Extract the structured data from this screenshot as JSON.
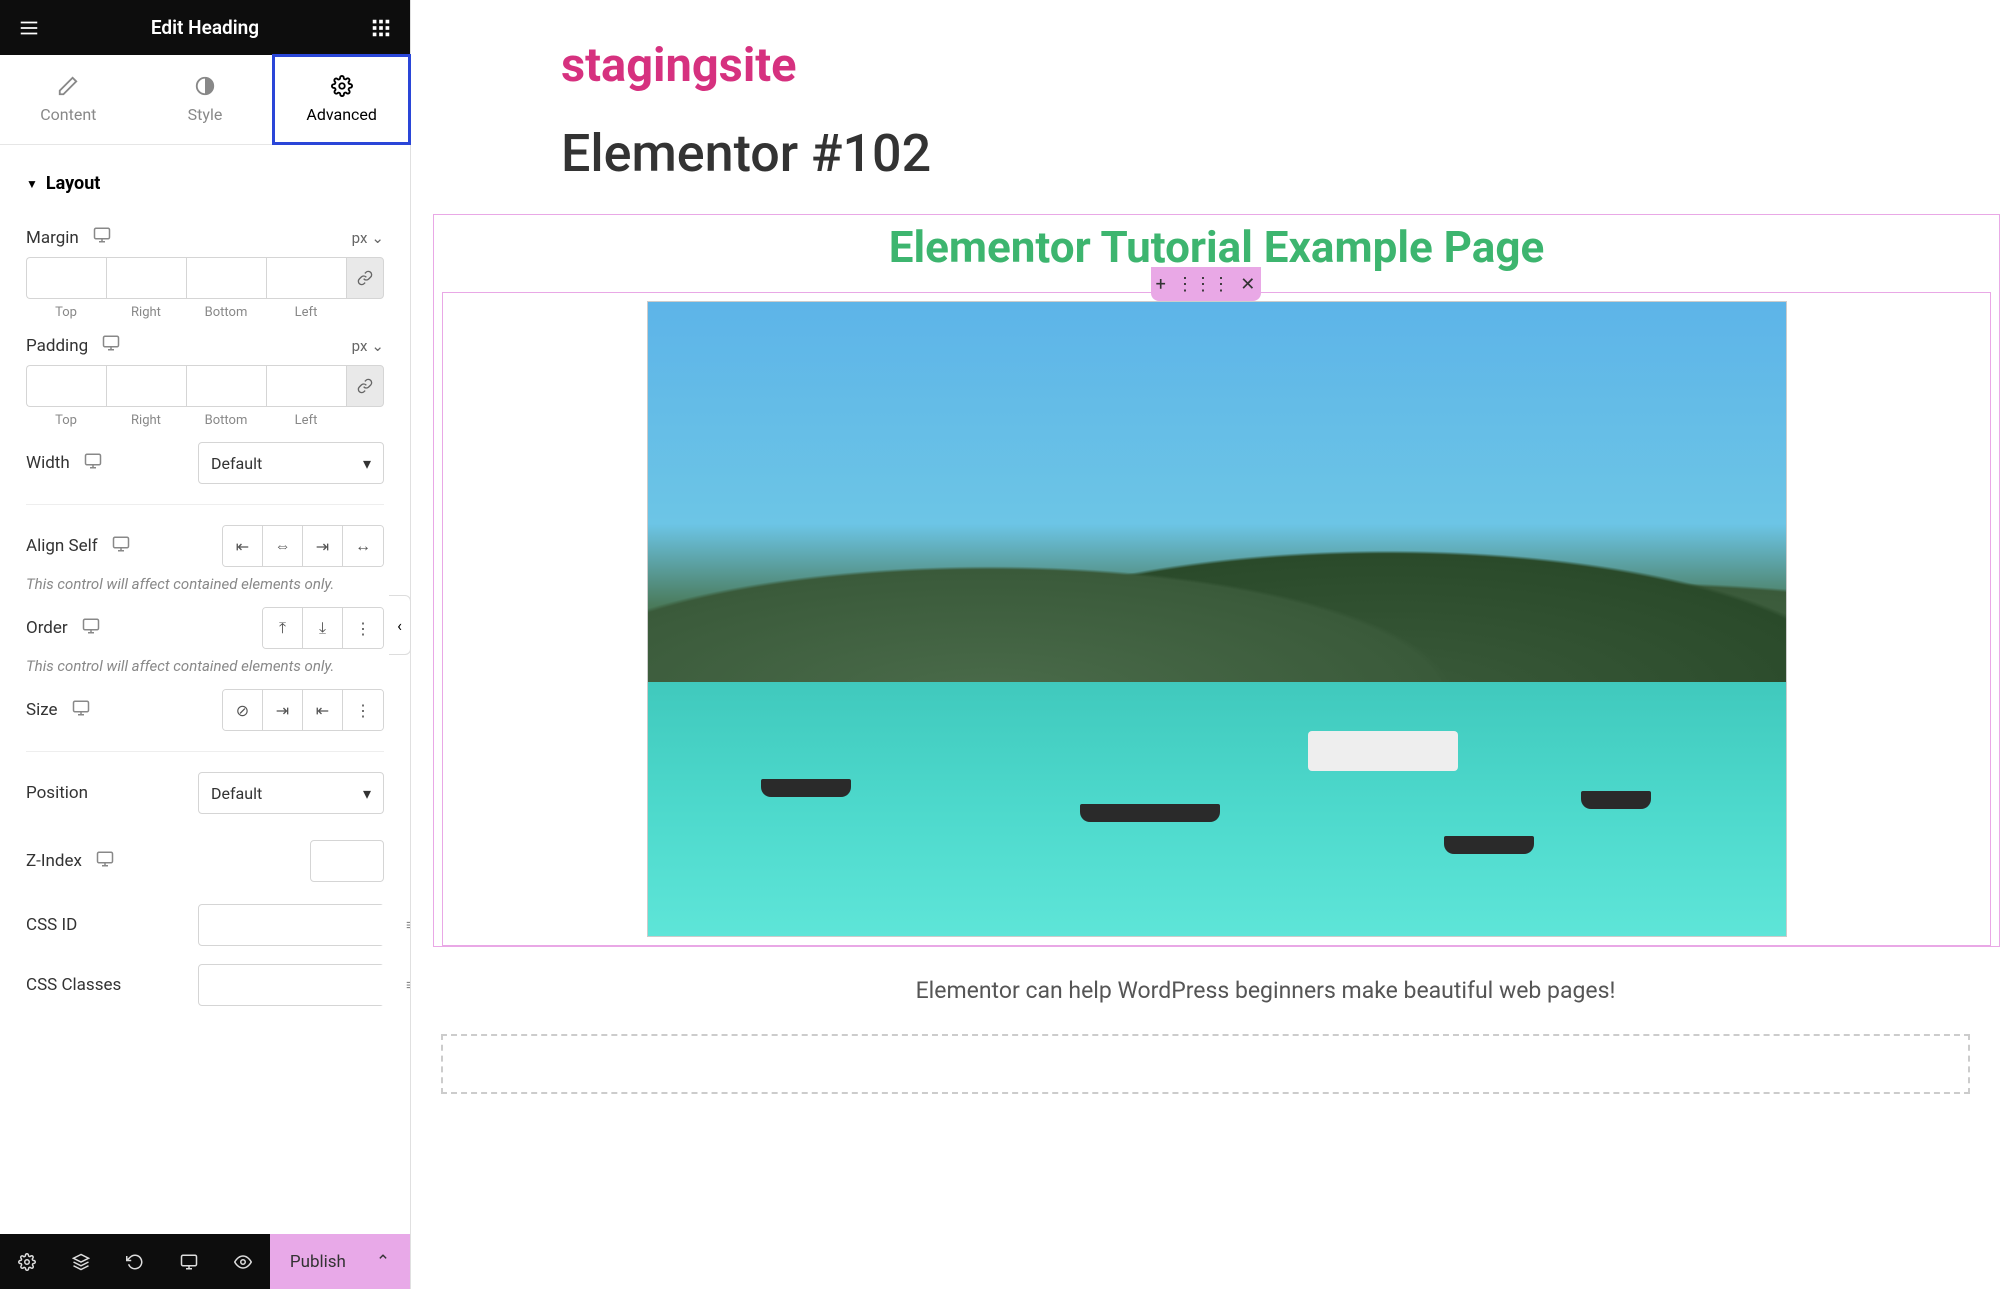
{
  "header": {
    "title": "Edit Heading"
  },
  "tabs": {
    "content": "Content",
    "style": "Style",
    "advanced": "Advanced"
  },
  "sections": {
    "layout": {
      "title": "Layout",
      "margin": {
        "label": "Margin",
        "unit": "px",
        "sides": [
          "Top",
          "Right",
          "Bottom",
          "Left"
        ]
      },
      "padding": {
        "label": "Padding",
        "unit": "px",
        "sides": [
          "Top",
          "Right",
          "Bottom",
          "Left"
        ]
      },
      "width": {
        "label": "Width",
        "value": "Default"
      },
      "align_self": {
        "label": "Align Self",
        "help": "This control will affect contained elements only."
      },
      "order": {
        "label": "Order",
        "help": "This control will affect contained elements only."
      },
      "size": {
        "label": "Size"
      },
      "position": {
        "label": "Position",
        "value": "Default"
      },
      "zindex": {
        "label": "Z-Index"
      },
      "css_id": {
        "label": "CSS ID"
      },
      "css_classes": {
        "label": "CSS Classes"
      }
    }
  },
  "footer": {
    "publish": "Publish"
  },
  "canvas": {
    "site_title": "stagingsite",
    "page_title": "Elementor #102",
    "heading": "Elementor Tutorial Example Page",
    "caption": "Elementor can help WordPress beginners make beautiful web pages!"
  }
}
